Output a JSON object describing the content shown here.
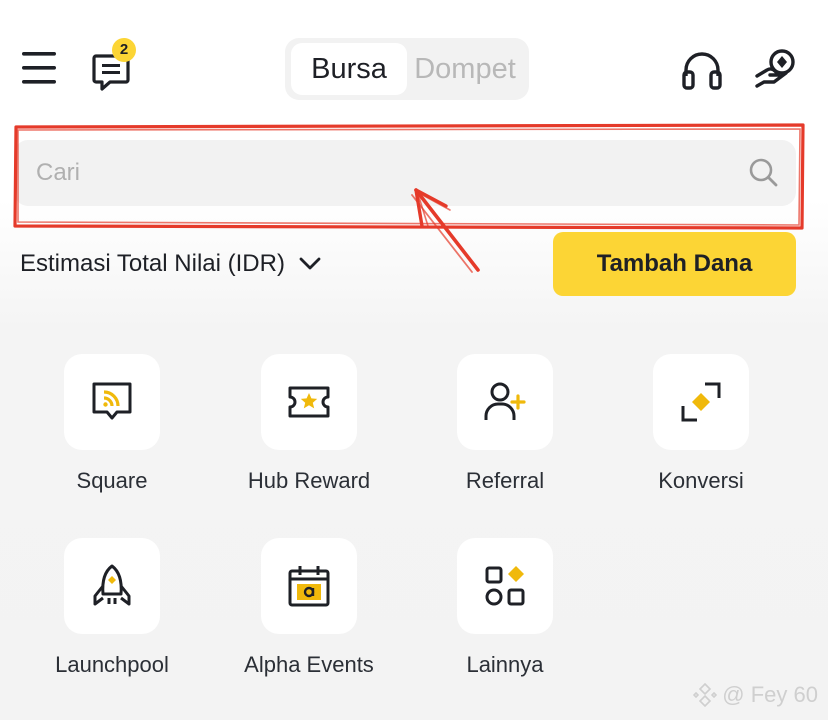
{
  "header": {
    "notification_count": "2",
    "tabs": [
      {
        "label": "Bursa",
        "active": true
      },
      {
        "label": "Dompet",
        "active": false
      }
    ]
  },
  "search": {
    "placeholder": "Cari"
  },
  "balance": {
    "label": "Estimasi Total Nilai (IDR)"
  },
  "cta": {
    "label": "Tambah Dana"
  },
  "shortcuts": [
    {
      "label": "Square",
      "icon": "square-icon"
    },
    {
      "label": "Hub Reward",
      "icon": "reward-ticket-icon"
    },
    {
      "label": "Referral",
      "icon": "add-user-icon"
    },
    {
      "label": "Konversi",
      "icon": "convert-icon"
    },
    {
      "label": "Launchpool",
      "icon": "rocket-icon"
    },
    {
      "label": "Alpha Events",
      "icon": "calendar-icon"
    },
    {
      "label": "Lainnya",
      "icon": "more-grid-icon"
    }
  ],
  "watermark": {
    "text": "@ Fey 60"
  },
  "colors": {
    "accent": "#fcd535",
    "annotation": "#e53a2a",
    "text": "#1e2026"
  }
}
